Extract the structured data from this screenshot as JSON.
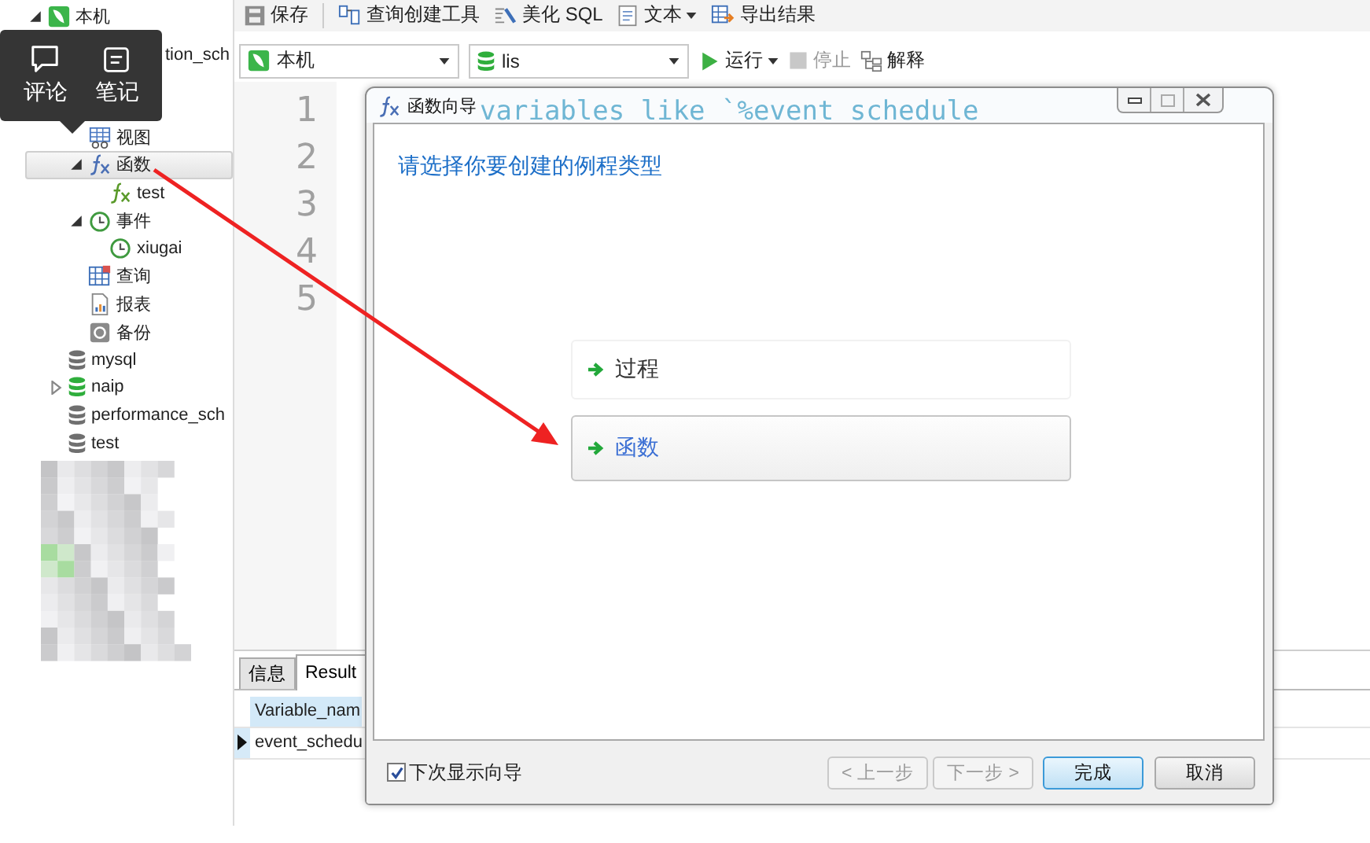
{
  "tooltip": {
    "buttons": [
      {
        "kind": "comment",
        "label": "评论"
      },
      {
        "kind": "note",
        "label": "笔记"
      }
    ]
  },
  "sidebar": {
    "tree": [
      {
        "kind": "connection",
        "label": "本机",
        "expanded": true,
        "selected": false,
        "children": [
          {
            "label": "tion_sch",
            "selected": false,
            "children": [
              {
                "kind": "view",
                "label": "视图",
                "selected": false
              },
              {
                "kind": "function",
                "label": "函数",
                "expanded": true,
                "selected": true,
                "children": [
                  {
                    "kind": "function-item",
                    "label": "test",
                    "selected": false
                  }
                ]
              },
              {
                "kind": "event",
                "label": "事件",
                "expanded": true,
                "selected": false,
                "children": [
                  {
                    "kind": "event-item",
                    "label": "xiugai",
                    "selected": false
                  }
                ]
              },
              {
                "kind": "query",
                "label": "查询",
                "selected": false
              },
              {
                "kind": "report",
                "label": "报表",
                "selected": false
              },
              {
                "kind": "backup",
                "label": "备份",
                "selected": false
              }
            ]
          },
          {
            "kind": "database",
            "label": "mysql",
            "open": false,
            "selected": false
          },
          {
            "kind": "database",
            "label": "naip",
            "open": true,
            "expanded": false,
            "selected": false
          },
          {
            "kind": "database",
            "label": "performance_sch",
            "open": false,
            "selected": false
          },
          {
            "kind": "database",
            "label": "test",
            "open": false,
            "selected": false
          }
        ]
      }
    ]
  },
  "toolbar": [
    {
      "kind": "save",
      "label": "保存",
      "dropdown": false
    },
    {
      "kind": "query-builder",
      "label": "查询创建工具",
      "dropdown": false
    },
    {
      "kind": "beautify",
      "label": "美化 SQL",
      "dropdown": false
    },
    {
      "kind": "text",
      "label": "文本",
      "dropdown": true
    },
    {
      "kind": "export",
      "label": "导出结果",
      "dropdown": false
    }
  ],
  "selectors": [
    {
      "kind": "connection",
      "value": "本机"
    },
    {
      "kind": "database",
      "value": "lis"
    }
  ],
  "run_controls": [
    {
      "kind": "run",
      "label": "运行",
      "dropdown": true,
      "disabled": false
    },
    {
      "kind": "stop",
      "label": "停止",
      "dropdown": false,
      "disabled": true
    },
    {
      "kind": "explain",
      "label": "解释",
      "dropdown": false,
      "disabled": false
    }
  ],
  "editor": {
    "line_numbers": [
      "1",
      "2",
      "3",
      "4",
      "5"
    ],
    "lines": [
      "variables like `%event schedule"
    ]
  },
  "results": {
    "tabs": [
      {
        "label": "信息",
        "selected": false
      },
      {
        "label": "Result",
        "selected": true
      }
    ],
    "columns": [
      "Variable_nam"
    ],
    "rows": [
      {
        "cells": [
          "event_schedu"
        ],
        "selected": true
      }
    ]
  },
  "dialog": {
    "title": "函数向导",
    "heading": "请选择你要创建的例程类型",
    "options": [
      {
        "label": "过程",
        "selected": false
      },
      {
        "label": "函数",
        "selected": true
      }
    ],
    "show_next_time": {
      "label": "下次显示向导",
      "checked": true
    },
    "buttons": [
      {
        "label": "< 上一步",
        "disabled": true,
        "default": false
      },
      {
        "label": "下一步 >",
        "disabled": true,
        "default": false
      },
      {
        "label": "完成",
        "disabled": false,
        "default": true
      },
      {
        "label": "取消",
        "disabled": false,
        "default": false
      }
    ]
  }
}
